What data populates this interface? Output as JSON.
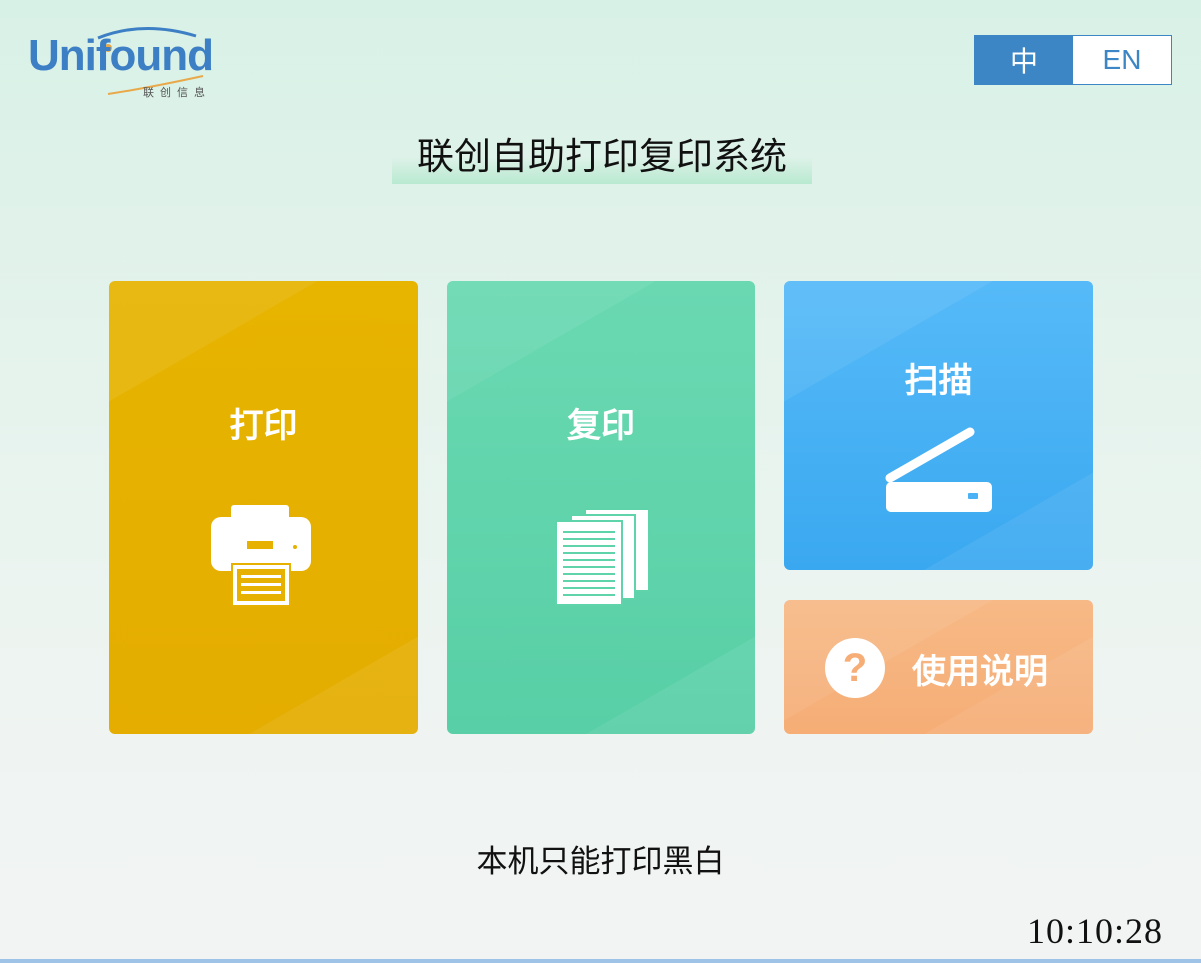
{
  "logo": {
    "brand": "Unifound",
    "subtitle": "联创信息"
  },
  "language": {
    "zh_label": "中",
    "en_label": "EN",
    "active": "zh"
  },
  "title": "联创自助打印复印系统",
  "tiles": {
    "print": {
      "label": "打印",
      "icon": "printer-icon",
      "color": "#e6b100"
    },
    "copy": {
      "label": "复印",
      "icon": "documents-icon",
      "color": "#5fd4ab"
    },
    "scan": {
      "label": "扫描",
      "icon": "scanner-icon",
      "color": "#4bb3f5"
    },
    "help": {
      "label": "使用说明",
      "icon": "question-icon",
      "glyph": "?",
      "color": "#f6b37e"
    }
  },
  "notice": "本机只能打印黑白",
  "clock": "10:10:28",
  "colors": {
    "accent_blue": "#3d86c6"
  }
}
